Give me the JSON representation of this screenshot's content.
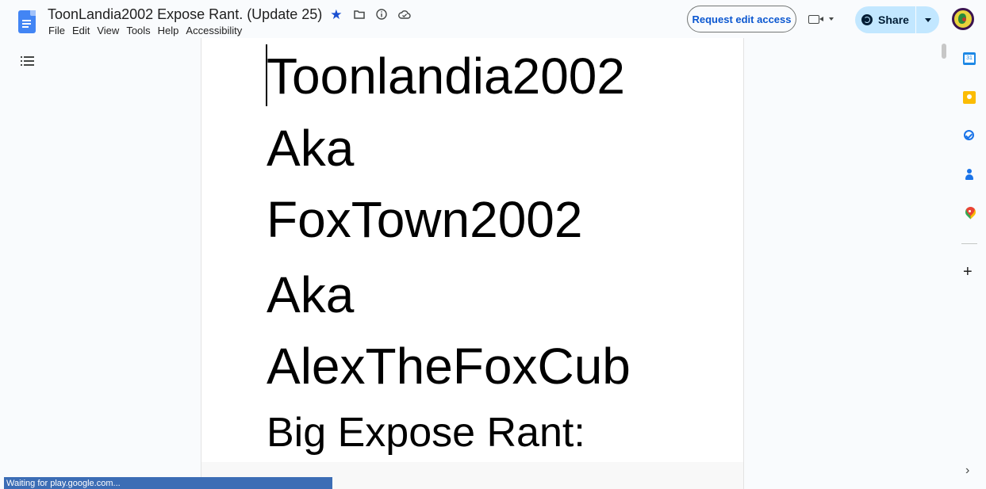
{
  "header": {
    "title": "ToonLandia2002 Expose Rant. (Update 25)",
    "menus": [
      "File",
      "Edit",
      "View",
      "Tools",
      "Help",
      "Accessibility"
    ],
    "request_edit_label": "Request edit access",
    "share_label": "Share",
    "icons": [
      "star-icon",
      "folder-icon",
      "info-icon",
      "cloud-saved-icon",
      "meet-camera-icon",
      "globe-icon",
      "share-dropdown-icon"
    ]
  },
  "document": {
    "lines": [
      "Toonlandia2002",
      "Aka",
      "FoxTown2002",
      "Aka",
      "AlexTheFoxCub",
      "Big Expose Rant:"
    ]
  },
  "side_panel": {
    "icons": [
      "calendar-icon",
      "keep-icon",
      "tasks-icon",
      "contacts-icon",
      "maps-icon",
      "add-icon",
      "chevron-right-icon"
    ],
    "calendar_day": "31"
  },
  "status": {
    "text": "Waiting for play.google.com..."
  },
  "colors": {
    "accent": "#0b57d0",
    "share_bg": "#c2e7ff",
    "doc_icon": "#4285f4",
    "status_bg": "#3c6db5"
  }
}
